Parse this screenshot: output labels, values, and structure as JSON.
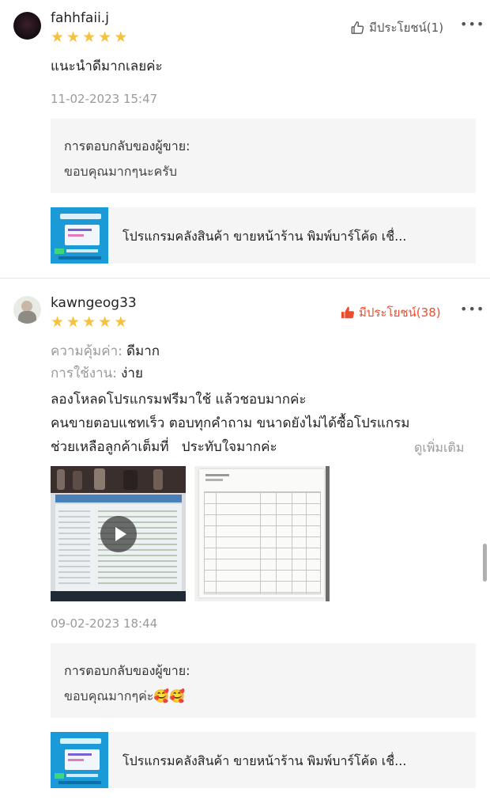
{
  "reviews": [
    {
      "username": "fahhfaii.j",
      "rating": 5,
      "helpful_label": "มีประโยชน์(1)",
      "helpful_active": false,
      "text": "แนะนำดีมากเลยค่ะ",
      "date": "11-02-2023 15:47",
      "reply_title": "การตอบกลับของผู้ขาย:",
      "reply_text": "ขอบคุณมากๆนะครับ",
      "product_name": "โปรแกรมคลังสินค้า ขายหน้าร้าน พิมพ์บาร์โค้ด เชื่..."
    },
    {
      "username": "kawngeog33",
      "rating": 5,
      "helpful_label": "มีประโยชน์(38)",
      "helpful_active": true,
      "attributes": [
        {
          "label": "ความคุ้มค่า:",
          "value": "ดีมาก"
        },
        {
          "label": "การใช้งาน:",
          "value": "ง่าย"
        }
      ],
      "text_lines": [
        "ลองโหลดโปรแกรมฟรีมาใช้ แล้วชอบมากค่ะ",
        "คนขายตอบแชทเร็ว ตอบทุกคำถาม ขนาดยังไม่ได้ซื้อโปรแกรม",
        "ช่วยเหลือลูกค้าเต็มที่   ประทับใจมากค่ะ"
      ],
      "see_more": "ดูเพิ่มเติม",
      "date": "09-02-2023 18:44",
      "reply_title": "การตอบกลับของผู้ขาย:",
      "reply_text": "ขอบคุณมากๆค่ะ🥰🥰",
      "product_name": "โปรแกรมคลังสินค้า ขายหน้าร้าน พิมพ์บาร์โค้ด เชื่..."
    }
  ],
  "colors": {
    "star": "#f6c23e",
    "helpful_active": "#ee4d2d",
    "muted": "#9a9a9a"
  },
  "icons": {
    "helpful_inactive": "thumbs-up-outline-icon",
    "helpful_active": "thumbs-up-filled-icon",
    "more": "more-dots-icon",
    "play": "play-icon"
  }
}
